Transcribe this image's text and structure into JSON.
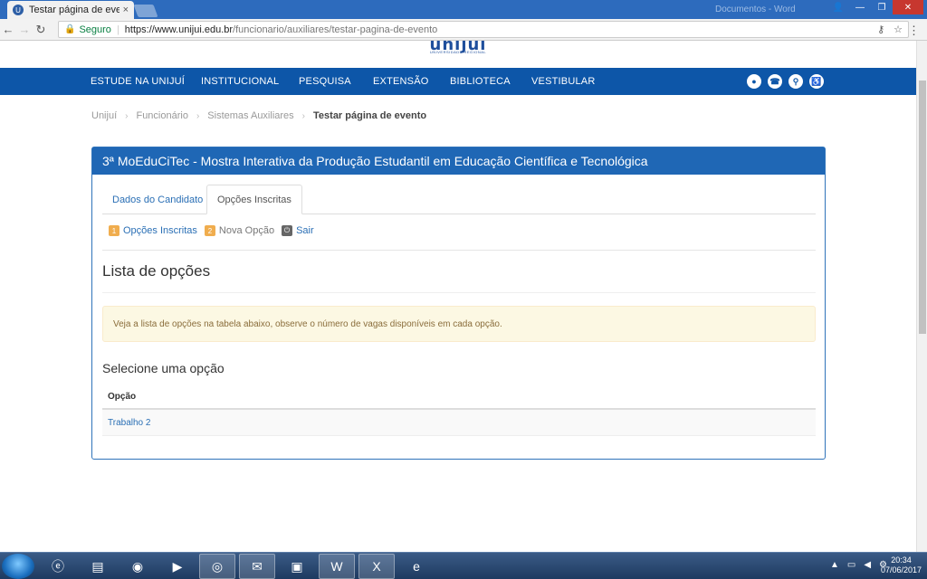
{
  "browser": {
    "tab_title": "Testar página de evento",
    "tab_close": "×",
    "profile_label": "Documentos - Word",
    "secure_label": "Seguro",
    "url_host": "https://www.unijui.edu.br",
    "url_path": "/funcionario/auxiliares/testar-pagina-de-evento"
  },
  "site": {
    "logo_text": "unijuí",
    "logo_sub": "UNIVERSIDADE REGIONAL",
    "nav": [
      "ESTUDE NA UNIJUÍ",
      "INSTITUCIONAL",
      "PESQUISA",
      "EXTENSÃO",
      "BIBLIOTECA",
      "VESTIBULAR"
    ]
  },
  "breadcrumb": {
    "items": [
      "Unijuí",
      "Funcionário",
      "Sistemas Auxiliares"
    ],
    "current": "Testar página de evento"
  },
  "panel": {
    "title": "3ª MoEduCiTec - Mostra Interativa da Produção Estudantil em Educação Científica e Tecnológica",
    "tabs": [
      "Dados do Candidato",
      "Opções Inscritas"
    ],
    "actions": [
      {
        "num": "1",
        "label": "Opções Inscritas"
      },
      {
        "num": "2",
        "label": "Nova Opção"
      },
      {
        "num": "⏻",
        "label": "Sair"
      }
    ],
    "list_heading": "Lista de opções",
    "alert": "Veja a lista de opções na tabela abaixo, observe o número de vagas disponíveis em cada opção.",
    "select_heading": "Selecione uma opção",
    "table_header": "Opção",
    "rows": [
      "Trabalho 2"
    ]
  },
  "taskbar": {
    "time": "20:34",
    "date": "07/06/2017"
  }
}
